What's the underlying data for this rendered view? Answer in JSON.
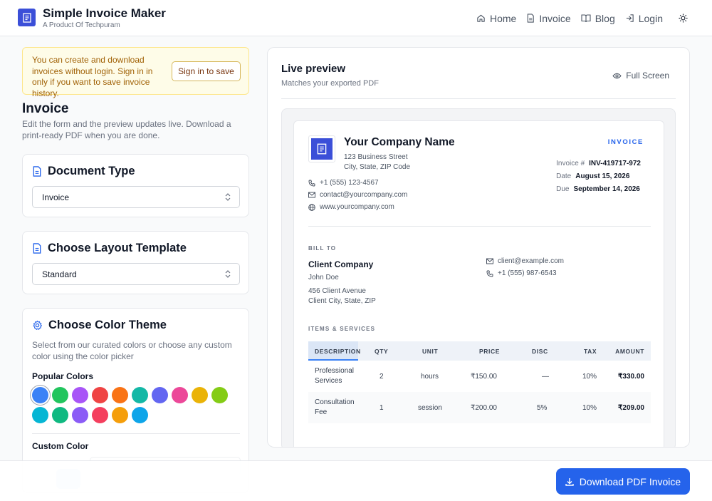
{
  "header": {
    "title": "Simple Invoice Maker",
    "subtitle": "A Product Of Techpuram",
    "nav": [
      {
        "label": "Home",
        "icon": "home-icon"
      },
      {
        "label": "Invoice",
        "icon": "document-icon"
      },
      {
        "label": "Blog",
        "icon": "book-icon"
      },
      {
        "label": "Login",
        "icon": "login-icon"
      }
    ],
    "theme_icon": "sun-icon"
  },
  "notice": {
    "text": "You can create and download invoices without login. Sign in in only if you want to save invoice history.",
    "button": "Sign in to save"
  },
  "form": {
    "title": "Invoice",
    "description": "Edit the form and the preview updates live. Download a print-ready PDF when you are done.",
    "document_type": {
      "title": "Document Type",
      "value": "Invoice"
    },
    "layout_template": {
      "title": "Choose Layout Template",
      "value": "Standard"
    },
    "color_theme": {
      "title": "Choose Color Theme",
      "description": "Select from our curated colors or choose any custom color using the color picker",
      "popular_label": "Popular Colors",
      "swatches": [
        "#3b82f6",
        "#22c55e",
        "#a855f7",
        "#ef4444",
        "#f97316",
        "#14b8a6",
        "#6366f1",
        "#ec4899",
        "#eab308",
        "#84cc16",
        "#06b6d4",
        "#10b981",
        "#8b5cf6",
        "#f43f5e",
        "#f59e0b",
        "#0ea5e9"
      ],
      "selected_color": "#3b82f6",
      "custom_label": "Custom Color"
    }
  },
  "preview": {
    "title": "Live preview",
    "subtitle": "Matches your exported PDF",
    "fullscreen": "Full Screen",
    "invoice": {
      "company_name": "Your Company Name",
      "address_line1": "123 Business Street",
      "address_line2": "City, State, ZIP Code",
      "phone": "+1 (555) 123-4567",
      "email": "contact@yourcompany.com",
      "website": "www.yourcompany.com",
      "heading": "INVOICE",
      "meta": {
        "number_label": "Invoice #",
        "number": "INV-419717-972",
        "date_label": "Date",
        "date": "August 15, 2026",
        "due_label": "Due",
        "due": "September 14, 2026"
      },
      "bill_to_label": "BILL TO",
      "client_company": "Client Company",
      "client_name": "John Doe",
      "client_address1": "456 Client Avenue",
      "client_address2": "Client City, State, ZIP",
      "client_email": "client@example.com",
      "client_phone": "+1 (555) 987-6543",
      "items_label": "ITEMS & SERVICES",
      "columns": [
        "DESCRIPTION",
        "QTY",
        "UNIT",
        "PRICE",
        "DISC",
        "TAX",
        "AMOUNT"
      ],
      "rows": [
        {
          "description": "Professional Services",
          "qty": "2",
          "unit": "hours",
          "price": "₹150.00",
          "disc": "—",
          "tax": "10%",
          "amount": "₹330.00"
        },
        {
          "description": "Consultation Fee",
          "qty": "1",
          "unit": "session",
          "price": "₹200.00",
          "disc": "5%",
          "tax": "10%",
          "amount": "₹209.00"
        }
      ]
    }
  },
  "download": {
    "label": "Download PDF Invoice",
    "icon": "download-icon"
  },
  "colors": {
    "accent": "#2563eb",
    "logo": "#3b4fd8",
    "notice_bg": "#fefce8"
  }
}
